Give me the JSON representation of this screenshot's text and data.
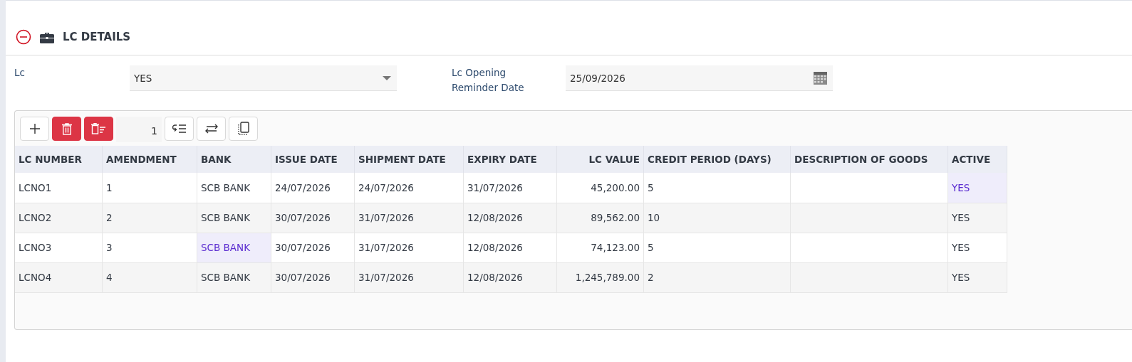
{
  "section": {
    "title": "LC DETAILS",
    "expanded": true
  },
  "form": [
    {
      "label": "Lc",
      "kind": "select",
      "value": "YES"
    },
    {
      "label": "Lc Opening Reminder Date",
      "kind": "date",
      "value": "25/09/2026"
    }
  ],
  "toolbar": {
    "page_value": "1"
  },
  "table": {
    "columns": [
      {
        "label": "LC NUMBER"
      },
      {
        "label": "AMENDMENT"
      },
      {
        "label": "BANK"
      },
      {
        "label": "ISSUE DATE"
      },
      {
        "label": "SHIPMENT DATE"
      },
      {
        "label": "EXPIRY DATE"
      },
      {
        "label": "LC VALUE"
      },
      {
        "label": "CREDIT PERIOD (DAYS)"
      },
      {
        "label": "DESCRIPTION OF GOODS"
      },
      {
        "label": "ACTIVE"
      }
    ],
    "rows": [
      {
        "cells": [
          {
            "text": "LCNO1",
            "selected": false
          },
          {
            "text": "1",
            "selected": false
          },
          {
            "text": "SCB BANK",
            "selected": false
          },
          {
            "text": "24/07/2026",
            "selected": false
          },
          {
            "text": "24/07/2026",
            "selected": false
          },
          {
            "text": "31/07/2026",
            "selected": false
          },
          {
            "text": "45,200.00",
            "selected": false
          },
          {
            "text": "5",
            "selected": false
          },
          {
            "selected": false
          },
          {
            "text": "YES",
            "selected": true
          }
        ]
      },
      {
        "cells": [
          {
            "text": "LCNO2",
            "selected": false
          },
          {
            "text": "2",
            "selected": false
          },
          {
            "text": "SCB BANK",
            "selected": false
          },
          {
            "text": "30/07/2026",
            "selected": false
          },
          {
            "text": "31/07/2026",
            "selected": false
          },
          {
            "text": "12/08/2026",
            "selected": false
          },
          {
            "text": "89,562.00",
            "selected": false
          },
          {
            "text": "10",
            "selected": false
          },
          {
            "selected": false
          },
          {
            "text": "YES",
            "selected": false
          }
        ]
      },
      {
        "cells": [
          {
            "text": "LCNO3",
            "selected": false
          },
          {
            "text": "3",
            "selected": false
          },
          {
            "text": "SCB BANK",
            "selected": true
          },
          {
            "text": "30/07/2026",
            "selected": false
          },
          {
            "text": "31/07/2026",
            "selected": false
          },
          {
            "text": "12/08/2026",
            "selected": false
          },
          {
            "text": "74,123.00",
            "selected": false
          },
          {
            "text": "5",
            "selected": false
          },
          {
            "selected": false
          },
          {
            "text": "YES",
            "selected": false
          }
        ]
      },
      {
        "cells": [
          {
            "text": "LCNO4",
            "selected": false
          },
          {
            "text": "4",
            "selected": false
          },
          {
            "text": "SCB BANK",
            "selected": false
          },
          {
            "text": "30/07/2026",
            "selected": false
          },
          {
            "text": "31/07/2026",
            "selected": false
          },
          {
            "text": "12/08/2026",
            "selected": false
          },
          {
            "text": "1,245,789.00",
            "selected": false
          },
          {
            "text": "2",
            "selected": false
          },
          {
            "selected": false
          },
          {
            "text": "YES",
            "selected": false
          }
        ]
      }
    ]
  }
}
